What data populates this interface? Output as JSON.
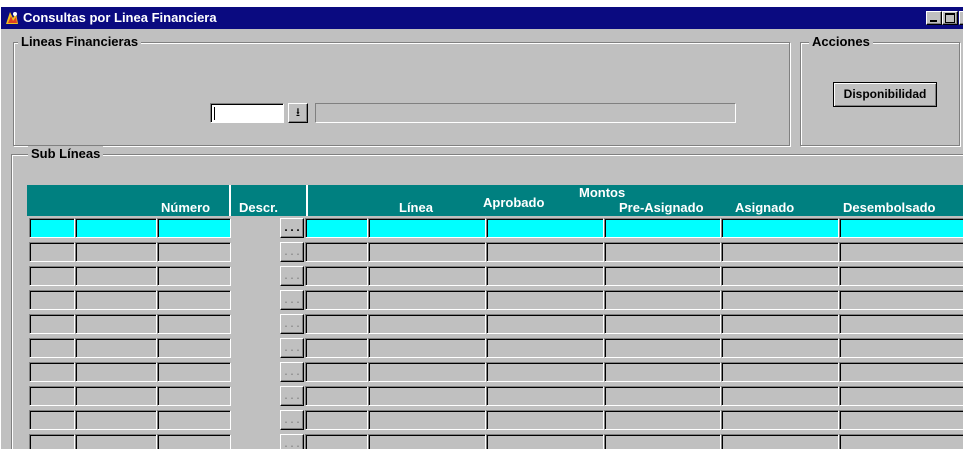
{
  "window": {
    "title": "Consultas por Linea Financiera",
    "app_icon": "oracle-forms-icon"
  },
  "lineas_financieras": {
    "group_label": "Lineas Financieras",
    "code_value": "",
    "description_value": "",
    "lov_glyph": "⭳"
  },
  "acciones": {
    "group_label": "Acciones",
    "disponibilidad_label": "Disponibilidad"
  },
  "sub_lineas": {
    "group_label": "Sub Líneas",
    "montos_label": "Montos",
    "columns": {
      "numero": "Número",
      "descr": "Descr.",
      "linea": "Línea",
      "aprobado": "Aprobado",
      "pre_asignado": "Pre-Asignado",
      "asignado": "Asignado",
      "desembolsado": "Desembolsado"
    },
    "ellipsis_label": "...",
    "active_row_color": "#00ffff",
    "header_color": "#008080",
    "row_count": 10,
    "active_row": 0
  }
}
